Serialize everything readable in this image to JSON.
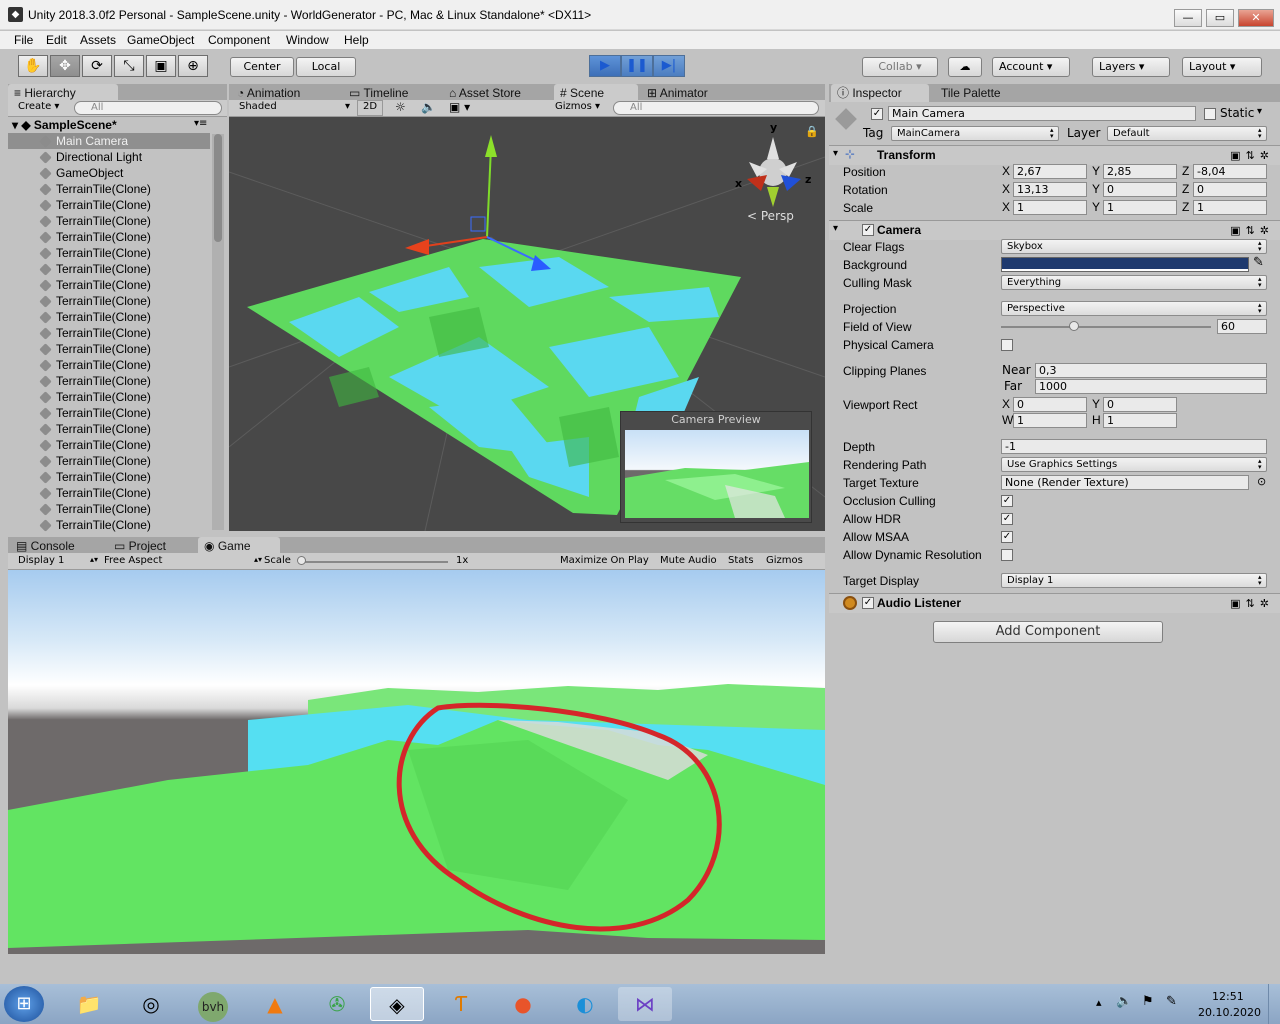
{
  "window": {
    "title": "Unity 2018.3.0f2 Personal - SampleScene.unity - WorldGenerator - PC, Mac & Linux Standalone* <DX11>",
    "min": "—",
    "max": "▭",
    "close": "✕"
  },
  "menu": [
    "File",
    "Edit",
    "Assets",
    "GameObject",
    "Component",
    "Window",
    "Help"
  ],
  "toolbar": {
    "pivot": "Center",
    "space": "Local",
    "collab": "Collab ▾",
    "account": "Account",
    "layers": "Layers",
    "layout": "Layout"
  },
  "hierarchy": {
    "tab": "Hierarchy",
    "create": "Create ▾",
    "search_placeholder": "All",
    "scene": "SampleScene*",
    "items": [
      "Main Camera",
      "Directional Light",
      "GameObject",
      "TerrainTile(Clone)",
      "TerrainTile(Clone)",
      "TerrainTile(Clone)",
      "TerrainTile(Clone)",
      "TerrainTile(Clone)",
      "TerrainTile(Clone)",
      "TerrainTile(Clone)",
      "TerrainTile(Clone)",
      "TerrainTile(Clone)",
      "TerrainTile(Clone)",
      "TerrainTile(Clone)",
      "TerrainTile(Clone)",
      "TerrainTile(Clone)",
      "TerrainTile(Clone)",
      "TerrainTile(Clone)",
      "TerrainTile(Clone)",
      "TerrainTile(Clone)",
      "TerrainTile(Clone)",
      "TerrainTile(Clone)",
      "TerrainTile(Clone)",
      "TerrainTile(Clone)",
      "TerrainTile(Clone)"
    ]
  },
  "scene": {
    "tabs": [
      "Animation",
      "Timeline",
      "Asset Store",
      "Scene",
      "Animator"
    ],
    "shading": "Shaded",
    "mode2d": "2D",
    "gizmos": "Gizmos ▾",
    "search_placeholder": "All",
    "persp": "Persp",
    "preview_title": "Camera Preview",
    "axis_x": "x",
    "axis_y": "y",
    "axis_z": "z"
  },
  "game": {
    "tabs": [
      "Console",
      "Project",
      "Game"
    ],
    "display": "Display 1",
    "aspect": "Free Aspect",
    "scale_label": "Scale",
    "scale_value": "1x",
    "maximize": "Maximize On Play",
    "mute": "Mute Audio",
    "stats": "Stats",
    "gizmos": "Gizmos"
  },
  "inspector": {
    "tabs": [
      "Inspector",
      "Tile Palette"
    ],
    "object_name": "Main Camera",
    "static": "Static",
    "tag_label": "Tag",
    "tag": "MainCamera",
    "layer_label": "Layer",
    "layer": "Default",
    "transform": {
      "title": "Transform",
      "position_label": "Position",
      "position": [
        "2,67",
        "2,85",
        "-8,04"
      ],
      "rotation_label": "Rotation",
      "rotation": [
        "13,13",
        "0",
        "0"
      ],
      "scale_label": "Scale",
      "scale": [
        "1",
        "1",
        "1"
      ]
    },
    "camera": {
      "title": "Camera",
      "clear_flags_label": "Clear Flags",
      "clear_flags": "Skybox",
      "background_label": "Background",
      "background_color": "#1f3a6e",
      "culling_label": "Culling Mask",
      "culling": "Everything",
      "projection_label": "Projection",
      "projection": "Perspective",
      "fov_label": "Field of View",
      "fov": "60",
      "physical_label": "Physical Camera",
      "clipping_label": "Clipping Planes",
      "near_label": "Near",
      "near": "0,3",
      "far_label": "Far",
      "far": "1000",
      "viewport_label": "Viewport Rect",
      "vx": "0",
      "vy": "0",
      "vw": "1",
      "vh": "1",
      "depth_label": "Depth",
      "depth": "-1",
      "rendering_label": "Rendering Path",
      "rendering": "Use Graphics Settings",
      "target_texture_label": "Target Texture",
      "target_texture": "None (Render Texture)",
      "occlusion_label": "Occlusion Culling",
      "hdr_label": "Allow HDR",
      "msaa_label": "Allow MSAA",
      "dynres_label": "Allow Dynamic Resolution",
      "target_display_label": "Target Display",
      "target_display": "Display 1"
    },
    "audio_listener": "Audio Listener",
    "add_component": "Add Component"
  },
  "taskbar": {
    "time": "12:51",
    "date": "20.10.2020"
  }
}
